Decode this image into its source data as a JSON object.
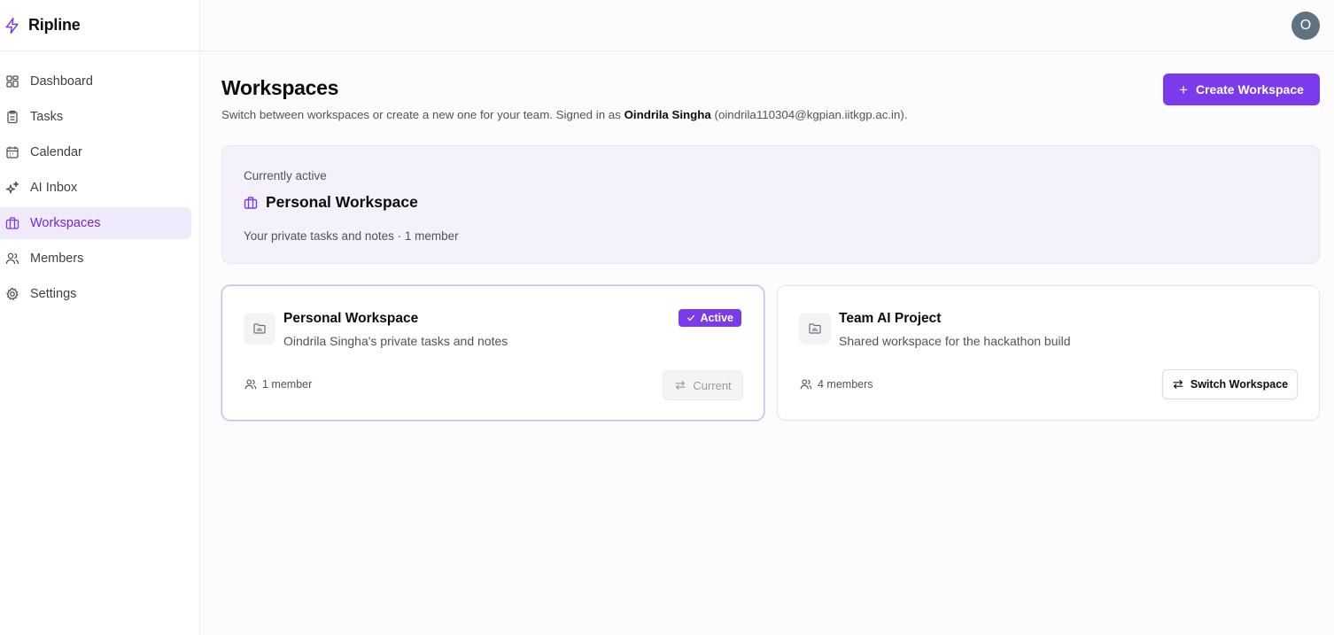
{
  "app": {
    "name": "Ripline",
    "logo_icon": "lightning-bolt-icon",
    "accent_color": "#7c3aed"
  },
  "sidebar": {
    "items": [
      {
        "label": "Dashboard",
        "icon": "dashboard-grid-icon",
        "active": false
      },
      {
        "label": "Tasks",
        "icon": "clipboard-icon",
        "active": false
      },
      {
        "label": "Calendar",
        "icon": "calendar-icon",
        "active": false
      },
      {
        "label": "AI Inbox",
        "icon": "sparkles-icon",
        "active": false
      },
      {
        "label": "Workspaces",
        "icon": "briefcase-icon",
        "active": true
      },
      {
        "label": "Members",
        "icon": "users-icon",
        "active": false
      },
      {
        "label": "Settings",
        "icon": "gear-icon",
        "active": false
      }
    ]
  },
  "header": {
    "avatar_initial": "O"
  },
  "page": {
    "title": "Workspaces",
    "subtitle_prefix": "Switch between workspaces or create a new one for your team. Signed in as ",
    "user_name": "Oindrila Singha",
    "user_email": " (oindrila110304@kgpian.iitkgp.ac.in).",
    "create_button": "Create Workspace"
  },
  "active_panel": {
    "caption": "Currently active",
    "name": "Personal Workspace",
    "description": "Your private tasks and notes · 1 member"
  },
  "cards": [
    {
      "name": "Personal Workspace",
      "description": "Oindrila Singha's private tasks and notes",
      "members": "1 member",
      "badge": "Active",
      "action": "Current"
    },
    {
      "name": "Team AI Project",
      "description": "Shared workspace for the hackathon build",
      "members": "4 members",
      "action": "Switch Workspace"
    }
  ]
}
